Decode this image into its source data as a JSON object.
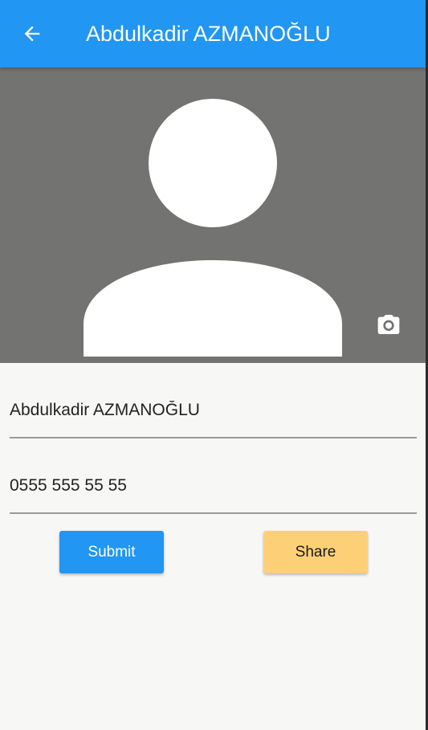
{
  "appbar": {
    "title": "Abdulkadir AZMANOĞLU",
    "back_icon": "arrow-back-icon"
  },
  "photo": {
    "placeholder_icon": "person-avatar-icon",
    "camera_icon": "camera-icon"
  },
  "form": {
    "name_value": "Abdulkadir AZMANOĞLU",
    "phone_value": "0555 555 55 55"
  },
  "buttons": {
    "submit_label": "Submit",
    "share_label": "Share"
  },
  "colors": {
    "primary": "#2196f3",
    "share": "#fdd078",
    "photo_bg": "#737472",
    "background": "#f7f7f5"
  }
}
